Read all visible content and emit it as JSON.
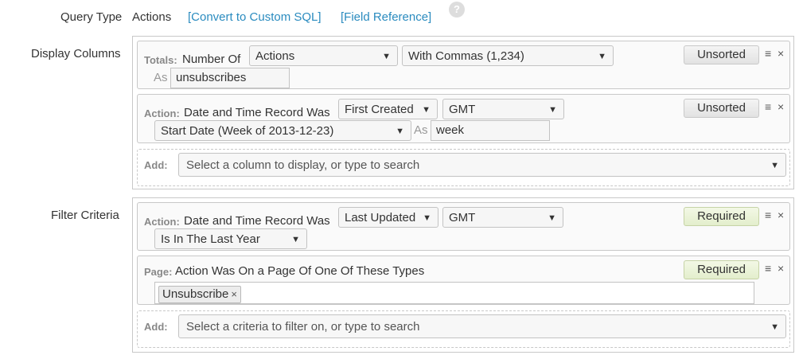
{
  "header": {
    "query_type_label": "Query Type",
    "query_type_value": "Actions",
    "convert_link": "[Convert to Custom SQL]",
    "field_ref_link": "[Field Reference]",
    "help_glyph": "?"
  },
  "display_columns": {
    "label": "Display Columns",
    "row1": {
      "tag": "Totals:",
      "text": "Number Of",
      "select1": "Actions",
      "select2": "With Commas (1,234)",
      "sort_btn": "Unsorted",
      "as_label": "As",
      "as_value": "unsubscribes"
    },
    "row2": {
      "tag": "Action:",
      "text": "Date and Time Record Was",
      "select1": "First Created",
      "select2": "GMT",
      "select3": "Start Date (Week of 2013-12-23)",
      "sort_btn": "Unsorted",
      "as_label": "As",
      "as_value": "week"
    },
    "add": {
      "tag": "Add:",
      "placeholder": "Select a column to display, or type to search"
    }
  },
  "filter_criteria": {
    "label": "Filter Criteria",
    "row1": {
      "tag": "Action:",
      "text": "Date and Time Record Was",
      "select1": "Last Updated",
      "select2": "GMT",
      "select3": "Is In The Last Year",
      "req_btn": "Required"
    },
    "row2": {
      "tag": "Page:",
      "text": "Action Was On a Page Of One Of These Types",
      "chip": "Unsubscribe",
      "chip_remove": "×",
      "req_btn": "Required"
    },
    "add": {
      "tag": "Add:",
      "placeholder": "Select a criteria to filter on, or type to search"
    }
  },
  "icons": {
    "drag": "≡",
    "remove": "×",
    "dropdown": "▼"
  }
}
